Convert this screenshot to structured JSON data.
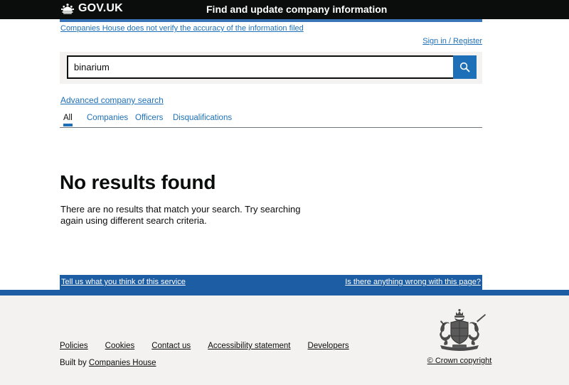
{
  "header": {
    "logo_text": "GOV.UK",
    "logo_icon": "crown-icon",
    "service_name": "Find and update company information"
  },
  "notice": {
    "disclaimer_link": "Companies House does not verify the accuracy of the information filed",
    "strip_color": "#3a75ba"
  },
  "account": {
    "signin_label": "Sign in / Register"
  },
  "search": {
    "value": "binarium",
    "placeholder": "",
    "button_icon": "search-icon",
    "button_label": "Search",
    "wrapper_color": "#f3f2f1",
    "button_color": "#1d70b8",
    "advanced_link": "Advanced company search"
  },
  "tabs": [
    {
      "label": "All",
      "active": true
    },
    {
      "label": "Companies",
      "active": false
    },
    {
      "label": "Officers",
      "active": false
    },
    {
      "label": "Disqualifications",
      "active": false
    }
  ],
  "main": {
    "title": "No results found",
    "body": "There are no results that match your search. Try searching again using different search criteria."
  },
  "feedback": {
    "left_link": "Tell us what you think of this service",
    "right_link": "Is there anything wrong with this page?",
    "background": "#1d5da3"
  },
  "footer": {
    "links": [
      "Policies",
      "Cookies",
      "Contact us",
      "Accessibility statement",
      "Developers"
    ],
    "built_by_prefix": "Built by ",
    "built_by_link": "Companies House",
    "crown_copyright": "© Crown copyright",
    "arms_icon": "royal-coat-of-arms-icon",
    "background": "#f3f2f1"
  },
  "colors": {
    "brand_blue": "#1d70b8",
    "header_black": "#0b0c0c",
    "grey": "#f3f2f1"
  }
}
